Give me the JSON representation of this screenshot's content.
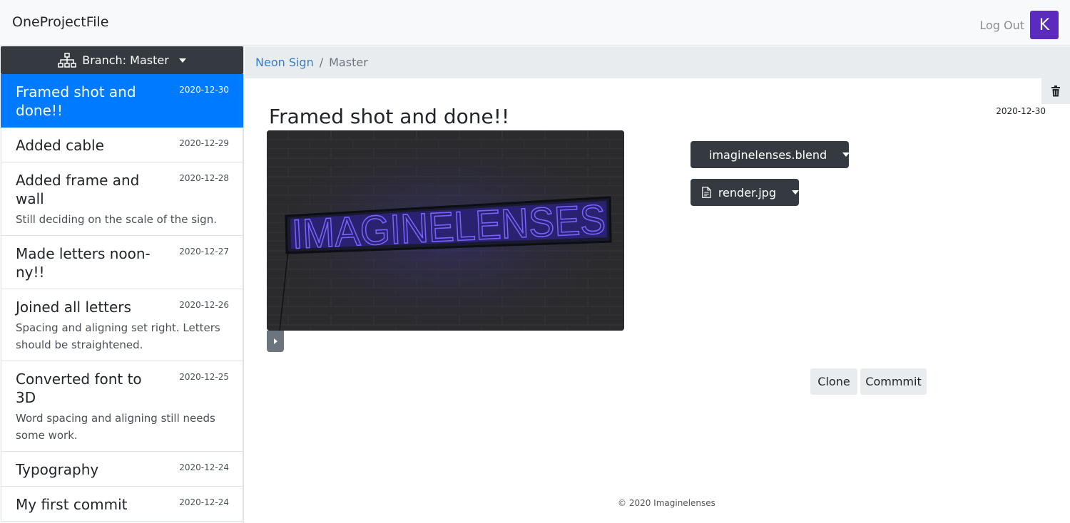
{
  "navbar": {
    "brand": "OneProjectFile",
    "logout_label": "Log Out",
    "avatar_initial": "K",
    "avatar_color": "#5b2bbd"
  },
  "sidebar": {
    "branch_label": "Branch: Master",
    "commits": [
      {
        "title": "Framed shot and done!!",
        "date": "2020-12-30",
        "description": ""
      },
      {
        "title": "Added cable",
        "date": "2020-12-29",
        "description": ""
      },
      {
        "title": "Added frame and wall",
        "date": "2020-12-28",
        "description": "Still deciding on the scale of the sign."
      },
      {
        "title": "Made letters noon-ny!!",
        "date": "2020-12-27",
        "description": ""
      },
      {
        "title": "Joined all letters",
        "date": "2020-12-26",
        "description": "Spacing and aligning set right. Letters should be straightened."
      },
      {
        "title": "Converted font to 3D",
        "date": "2020-12-25",
        "description": "Word spacing and aligning still needs some work."
      },
      {
        "title": "Typography",
        "date": "2020-12-24",
        "description": ""
      },
      {
        "title": "My first commit",
        "date": "2020-12-24",
        "description": ""
      }
    ]
  },
  "breadcrumb": {
    "project": "Neon Sign",
    "separator": "/",
    "branch": "Master"
  },
  "main": {
    "title": "Framed shot and done!!",
    "date": "2020-12-30",
    "preview_text": "IMAGINELENSES",
    "files": [
      {
        "name": "imaginelenses.blend"
      },
      {
        "name": "render.jpg"
      }
    ],
    "clone_label": "Clone",
    "commit_label": "Commmit"
  },
  "footer": {
    "copyright": "© 2020 Imaginelenses"
  },
  "colors": {
    "accent": "#007bff",
    "dark": "#343a40",
    "neon": "#6b4dff"
  }
}
